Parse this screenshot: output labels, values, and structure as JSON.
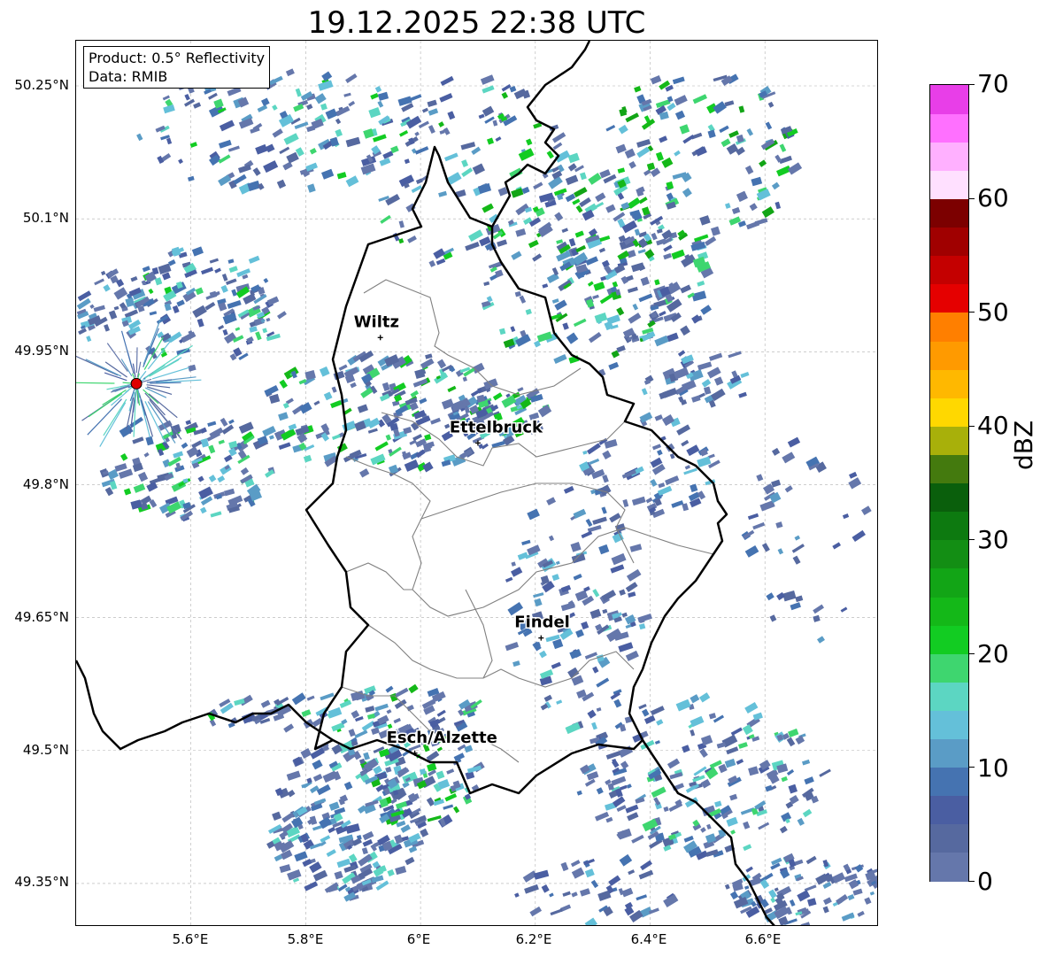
{
  "title": "19.12.2025 22:38 UTC",
  "info": {
    "product": "Product: 0.5° Reflectivity",
    "source": "Data: RMIB"
  },
  "lat_labels": [
    "50.25°N",
    "50.1°N",
    "49.95°N",
    "49.8°N",
    "49.65°N",
    "49.5°N",
    "49.35°N"
  ],
  "lon_labels": [
    "5.6°E",
    "5.8°E",
    "6°E",
    "6.2°E",
    "6.4°E",
    "6.6°E"
  ],
  "cities": [
    {
      "name": "Wiltz",
      "lon": 5.93,
      "lat": 49.966
    },
    {
      "name": "Ettelbruck",
      "lon": 6.1,
      "lat": 49.847
    },
    {
      "name": "Findel",
      "lon": 6.21,
      "lat": 49.627
    },
    {
      "name": "Esch/Alzette",
      "lon": 5.99,
      "lat": 49.497
    }
  ],
  "radar_site": {
    "lon": 5.505,
    "lat": 49.914
  },
  "colorbar": {
    "label": "dBZ",
    "tick_labels": [
      "0",
      "10",
      "20",
      "30",
      "40",
      "50",
      "60",
      "70"
    ],
    "min": 0,
    "max": 70,
    "step": 2.5,
    "colors": [
      "#6577ab",
      "#56699f",
      "#4a5ea2",
      "#4573b1",
      "#5a9cc6",
      "#64c0d9",
      "#5cd6c2",
      "#3ed66f",
      "#12cc22",
      "#14b818",
      "#12a516",
      "#138e14",
      "#0d7a10",
      "#0a5f0c",
      "#447a0e",
      "#a8b00a",
      "#ffd800",
      "#ffb800",
      "#ff9a00",
      "#ff7f00",
      "#e50000",
      "#c40000",
      "#a00000",
      "#7c0000",
      "#ffe0ff",
      "#ffb0ff",
      "#ff70ff",
      "#e83ee8"
    ]
  },
  "colors": {
    "border": "#000000",
    "canton": "#808080",
    "grid": "#b0b0b0",
    "radar_site": "#e00000"
  }
}
